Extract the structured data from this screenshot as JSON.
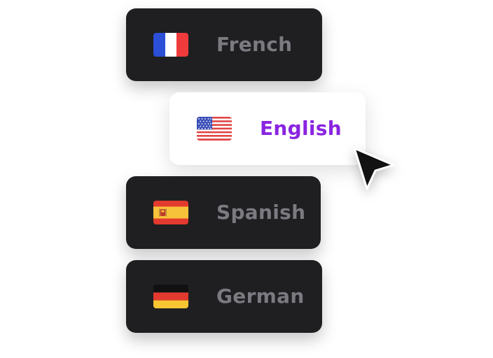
{
  "languages": [
    {
      "label": "French",
      "flag": "france-flag-icon"
    },
    {
      "label": "English",
      "flag": "usa-flag-icon",
      "selected": true
    },
    {
      "label": "Spanish",
      "flag": "spain-flag-icon"
    },
    {
      "label": "German",
      "flag": "germany-flag-icon"
    }
  ],
  "colors": {
    "card_dark": "#1f1f22",
    "label_muted": "#7a7a80",
    "label_selected": "#8a24e0",
    "cursor": "#121212"
  }
}
